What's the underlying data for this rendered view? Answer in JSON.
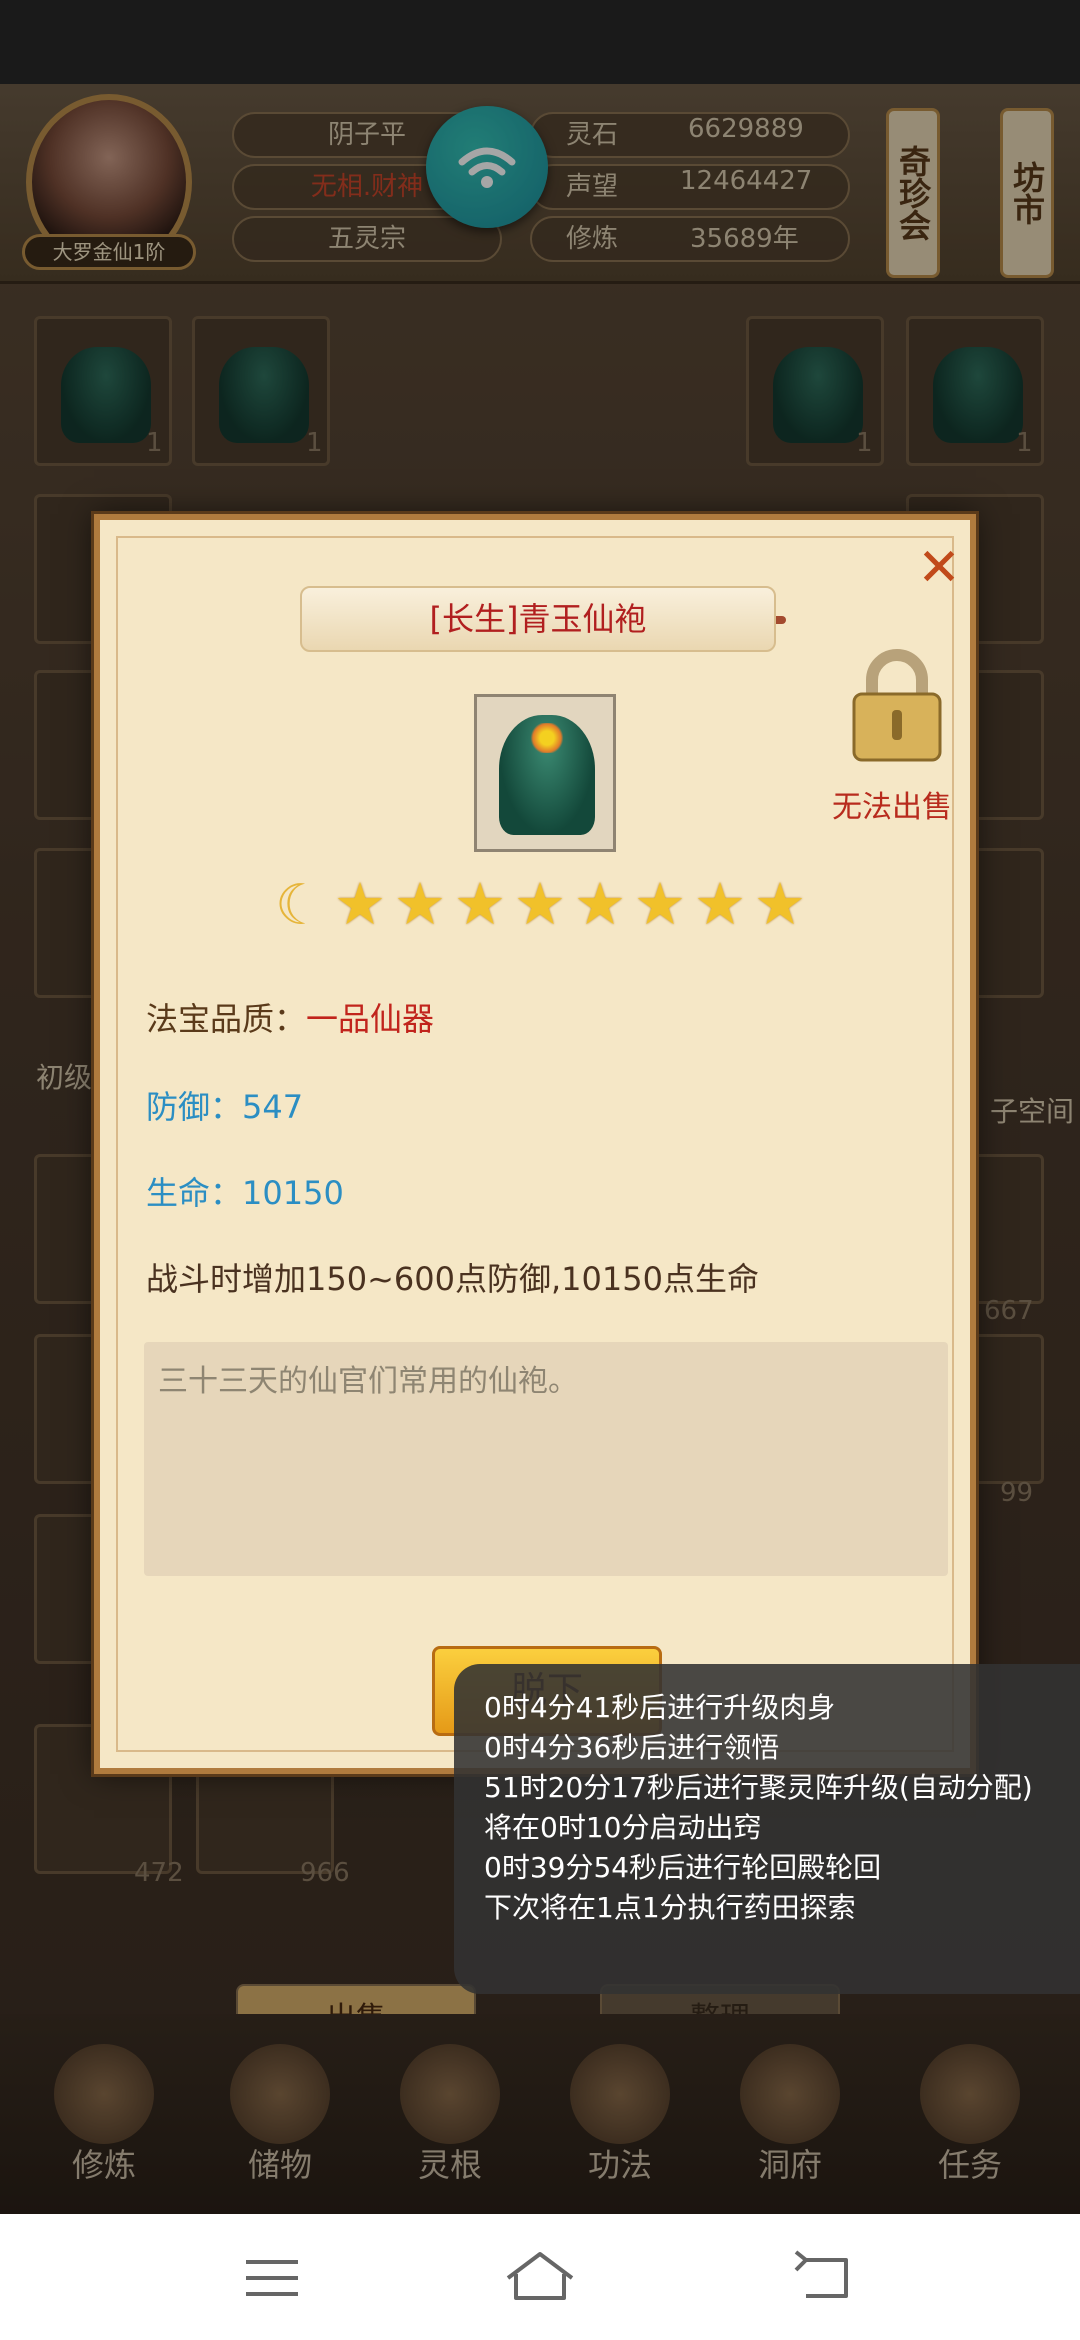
{
  "header": {
    "rank": "大罗金仙1阶",
    "player_name": "阴子平",
    "title_label": "无相.财神",
    "sect": "五灵宗",
    "stats": [
      {
        "label": "灵石",
        "value": "6629889"
      },
      {
        "label": "声望",
        "value": "12464427"
      },
      {
        "label": "修炼",
        "value": "35689年"
      }
    ],
    "side_buttons": [
      "奇珍会",
      "坊市"
    ]
  },
  "background": {
    "side_tag_left": "初级",
    "side_tag_right": "子空间",
    "counts": [
      "1",
      "1",
      "1",
      "1",
      "667",
      "99",
      "472",
      "966"
    ],
    "sell_button": "出售",
    "sort_button": "整理"
  },
  "bottom_nav": [
    "修炼",
    "储物",
    "灵根",
    "功法",
    "洞府",
    "任务"
  ],
  "modal": {
    "title": "[长生]青玉仙袍",
    "lock_label": "无法出售",
    "moon_count": 1,
    "star_count": 8,
    "quality_label": "法宝品质：",
    "quality_value": "一品仙器",
    "defense": "防御：547",
    "life": "生命：10150",
    "effect": "战斗时增加150~600点防御,10150点生命",
    "description": "三十三天的仙官们常用的仙袍。",
    "unequip_button": "脱下"
  },
  "log": [
    "0时4分41秒后进行升级肉身",
    "0时4分36秒后进行领悟",
    "51时20分17秒后进行聚灵阵升级(自动分配)",
    "将在0时10分启动出窍",
    "0时39分54秒后进行轮回殿轮回",
    "下次将在1点1分执行药田探索"
  ]
}
